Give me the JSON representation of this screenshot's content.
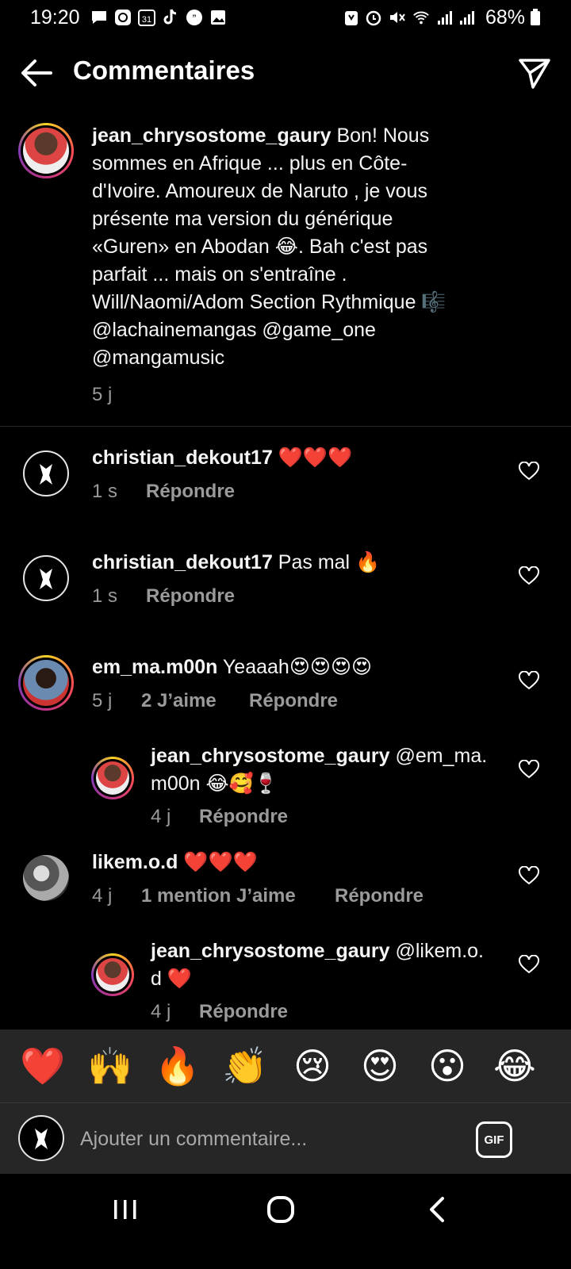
{
  "status_bar": {
    "time": "19:20",
    "battery": "68%",
    "left_icons": [
      "message-icon",
      "app-icon",
      "calendar-icon",
      "tiktok-icon",
      "quote-icon",
      "gallery-icon"
    ],
    "right_icons": [
      "nfc-icon",
      "alarm-icon",
      "mute-icon",
      "wifi-icon",
      "signal-icon",
      "signal-icon",
      "battery-icon"
    ],
    "calendar_day": "31"
  },
  "header": {
    "title": "Commentaires"
  },
  "caption": {
    "username": "jean_chrysostome_gaury",
    "lines": [
      " Bon! Nous",
      "sommes en Afrique ... plus en Côte-",
      "d'Ivoire.  Amoureux de Naruto , je vous",
      "présente ma version du générique",
      "«Guren» en Abodan 😂. Bah c'est pas",
      "parfait ... mais on s'entraîne .",
      "Will/Naomi/Adom Section Rythmique 🎼",
      "@lachainemangas @game_one",
      "@mangamusic"
    ],
    "time": "5 j"
  },
  "comments": [
    {
      "username": "christian_dekout17",
      "text": " ❤️❤️❤️",
      "time": "1 s",
      "likes": "",
      "reply": "Répondre"
    },
    {
      "username": "christian_dekout17",
      "text": " Pas mal 🔥",
      "time": "1 s",
      "likes": "",
      "reply": "Répondre"
    },
    {
      "username": "em_ma.m00n",
      "text": " Yeaaah😍😍😍😍",
      "time": "5 j",
      "likes": "2 J’aime",
      "reply": "Répondre"
    },
    {
      "username": "jean_chrysostome_gaury",
      "text": " @em_ma.",
      "text2": "m00n 😂🥰🍷",
      "time": "4 j",
      "likes": "",
      "reply": "Répondre"
    },
    {
      "username": "likem.o.d",
      "text": " ❤️❤️❤️",
      "time": "4 j",
      "likes": "1 mention J’aime",
      "reply": "Répondre"
    },
    {
      "username": "jean_chrysostome_gaury",
      "text": " @likem.o.",
      "text2": "d ❤️",
      "time": "4 j",
      "likes": "",
      "reply": "Répondre"
    }
  ],
  "reactions": [
    "❤️",
    "🙌",
    "🔥",
    "👏",
    "😢",
    "😍",
    "😮",
    "😂"
  ],
  "composer": {
    "placeholder": "Ajouter un commentaire...",
    "gif_label": "GIF"
  },
  "nav_icons": [
    "recent-apps-icon",
    "home-icon",
    "back-icon"
  ]
}
